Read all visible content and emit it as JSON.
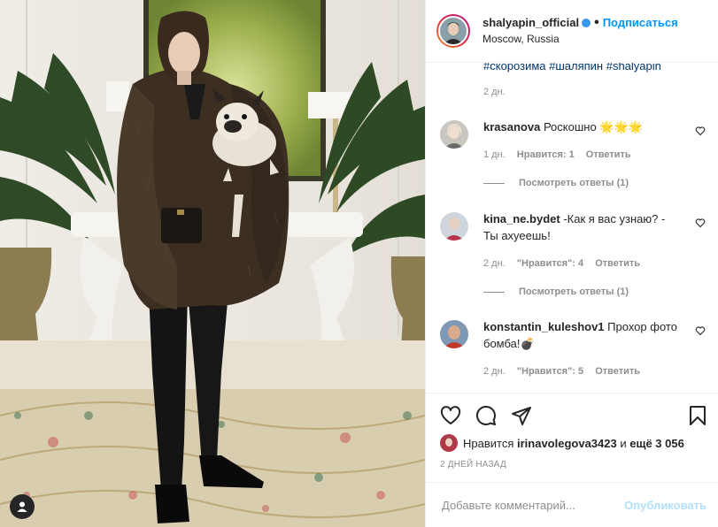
{
  "header": {
    "username": "shalyapin_official",
    "follow_label": "Подписаться",
    "location": "Moscow, Russia"
  },
  "caption": {
    "hashtags": "#скорозима #шаляпин #shalyapin",
    "time": "2 дн."
  },
  "comments": [
    {
      "username": "krasanova",
      "text": "Роскошно 🌟🌟🌟",
      "time": "1 дн.",
      "likes": "Нравится: 1",
      "reply_label": "Ответить",
      "view_replies": "Посмотреть ответы (1)"
    },
    {
      "username": "kina_ne.bydet",
      "text": "-Как я вас узнаю? - Ты ахуеешь!",
      "time": "2 дн.",
      "likes": "\"Нравится\": 4",
      "reply_label": "Ответить",
      "view_replies": "Посмотреть ответы (1)"
    },
    {
      "username": "konstantin_kuleshov1",
      "text": "Прохор фото бомба!💣",
      "time": "2 дн.",
      "likes": "\"Нравится\": 5",
      "reply_label": "Ответить"
    }
  ],
  "likes": {
    "prefix": "Нравится",
    "user": "irinavolegova3423",
    "connector": "и",
    "others": "ещё 3 056"
  },
  "posted": "2 ДНЕЙ НАЗАД",
  "add_comment": {
    "placeholder": "Добавьте комментарий...",
    "publish_label": "Опубликовать"
  },
  "icons": [
    "heart-icon",
    "comment-icon",
    "share-icon",
    "bookmark-icon",
    "user-tag-icon"
  ],
  "colors": {
    "link": "#0095f6",
    "verified": "#3897f0",
    "muted": "#8e8e8e",
    "publish_disabled": "#b2dffc"
  }
}
